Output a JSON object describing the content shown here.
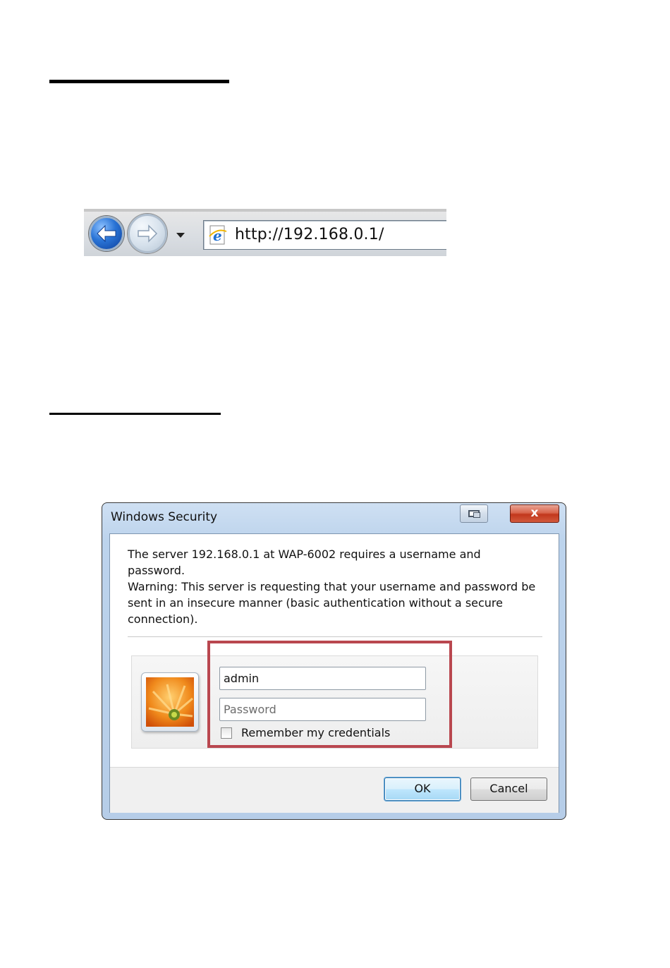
{
  "browser": {
    "address": "http://192.168.0.1/",
    "icons": {
      "back": "back-arrow-icon",
      "forward": "forward-arrow-icon",
      "dropdown": "chevron-down-icon",
      "page": "ie-page-icon"
    }
  },
  "dialog": {
    "title": "Windows Security",
    "close_label": "x",
    "message": "The server 192.168.0.1 at WAP-6002 requires a username and password.",
    "warning": "Warning: This server is requesting that your username and password be sent in an insecure manner (basic authentication without a secure connection).",
    "username_value": "admin",
    "password_placeholder": "Password",
    "remember_label": "Remember my credentials",
    "remember_checked": false,
    "ok_label": "OK",
    "cancel_label": "Cancel",
    "highlight_color": "#b9474f"
  }
}
